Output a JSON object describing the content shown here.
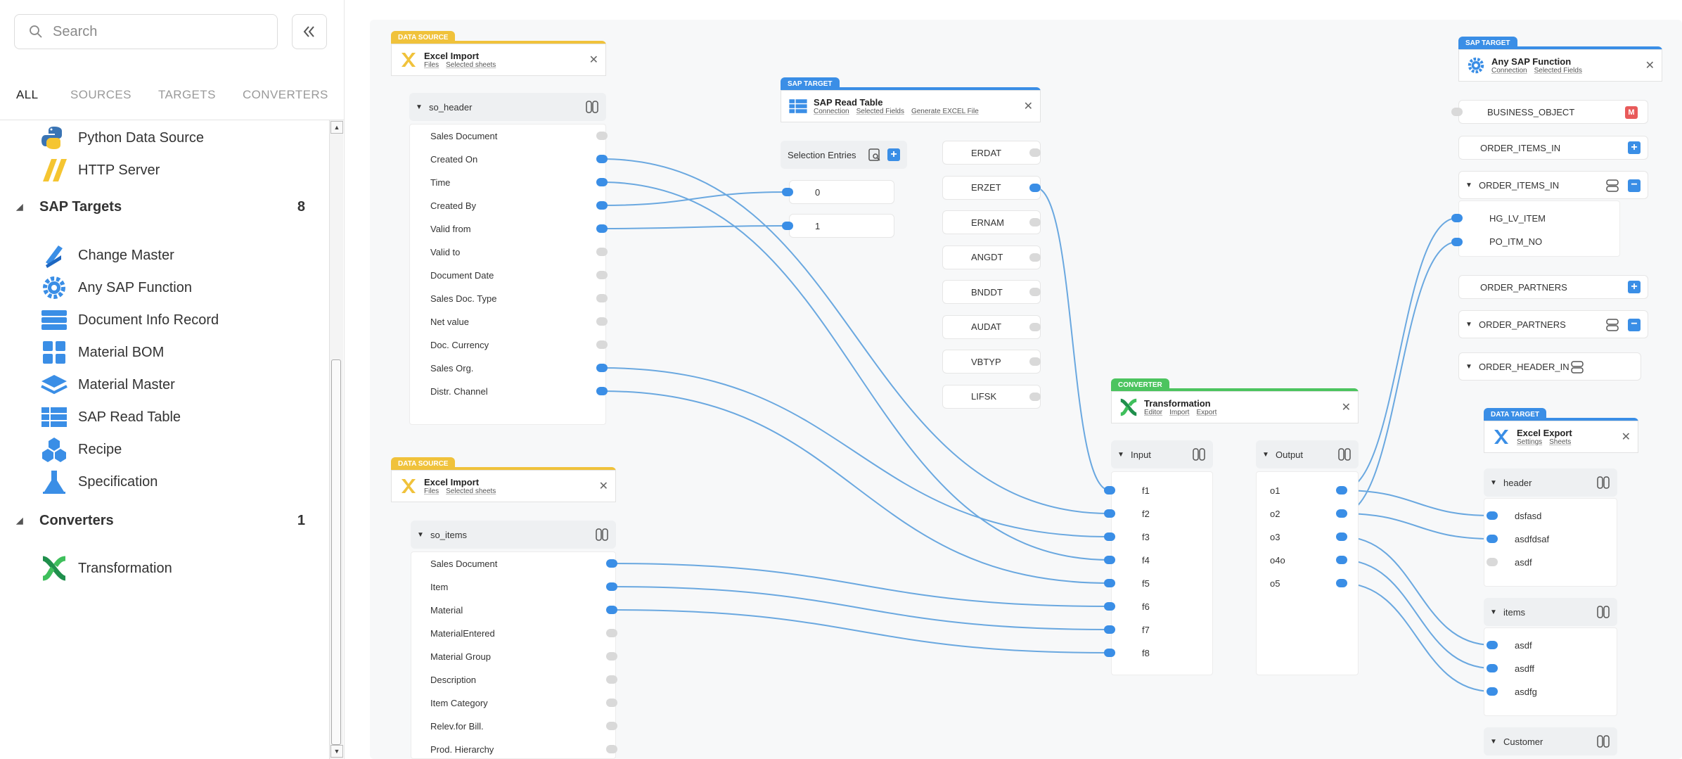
{
  "search": {
    "placeholder": "Search"
  },
  "tabs": [
    {
      "label": "ALL",
      "active": true
    },
    {
      "label": "SOURCES"
    },
    {
      "label": "TARGETS"
    },
    {
      "label": "CONVERTERS"
    }
  ],
  "library": {
    "items_top": [
      {
        "label": "Python Data Source",
        "icon": "python-icon"
      },
      {
        "label": "HTTP Server",
        "icon": "http-server-icon"
      }
    ],
    "sap_targets": {
      "label": "SAP Targets",
      "count": "8",
      "items": [
        {
          "label": "Change Master",
          "icon": "change-master-icon"
        },
        {
          "label": "Any SAP Function",
          "icon": "gear-icon"
        },
        {
          "label": "Document Info Record",
          "icon": "document-info-icon"
        },
        {
          "label": "Material BOM",
          "icon": "material-bom-icon"
        },
        {
          "label": "Material Master",
          "icon": "layers-icon"
        },
        {
          "label": "SAP Read Table",
          "icon": "table-icon"
        },
        {
          "label": "Recipe",
          "icon": "recipe-icon"
        },
        {
          "label": "Specification",
          "icon": "flask-icon"
        }
      ]
    },
    "converters": {
      "label": "Converters",
      "count": "1",
      "items": [
        {
          "label": "Transformation",
          "icon": "transformation-icon"
        }
      ]
    }
  },
  "colors": {
    "source": "#f0c23b",
    "sap_target": "#3a8ee6",
    "converter": "#4cc45f",
    "data_target": "#3a8ee6",
    "wire": "#6aa8e0"
  },
  "nodes": {
    "excel_import_1": {
      "badge": "DATA SOURCE",
      "title": "Excel Import",
      "links": [
        "Files",
        "Selected sheets"
      ],
      "group": "so_header",
      "fields": [
        {
          "label": "Sales Document",
          "connected": false
        },
        {
          "label": "Created On",
          "connected": true
        },
        {
          "label": "Time",
          "connected": true
        },
        {
          "label": "Created By",
          "connected": true
        },
        {
          "label": "Valid from",
          "connected": true
        },
        {
          "label": "Valid to",
          "connected": false
        },
        {
          "label": "Document Date",
          "connected": false
        },
        {
          "label": "Sales Doc. Type",
          "connected": false
        },
        {
          "label": "Net value",
          "connected": false
        },
        {
          "label": "Doc. Currency",
          "connected": false
        },
        {
          "label": "Sales Org.",
          "connected": true
        },
        {
          "label": "Distr. Channel",
          "connected": true
        }
      ]
    },
    "excel_import_2": {
      "badge": "DATA SOURCE",
      "title": "Excel Import",
      "links": [
        "Files",
        "Selected sheets"
      ],
      "group": "so_items",
      "fields": [
        {
          "label": "Sales Document",
          "connected": true
        },
        {
          "label": "Item",
          "connected": true
        },
        {
          "label": "Material",
          "connected": true
        },
        {
          "label": "MaterialEntered",
          "connected": false
        },
        {
          "label": "Material Group",
          "connected": false
        },
        {
          "label": "Description",
          "connected": false
        },
        {
          "label": "Item Category",
          "connected": false
        },
        {
          "label": "Relev.for Bill.",
          "connected": false
        },
        {
          "label": "Prod. Hierarchy",
          "connected": false
        }
      ]
    },
    "sap_read_table": {
      "badge": "SAP TARGET",
      "title": "SAP Read Table",
      "links": [
        "Connection",
        "Selected Fields",
        "Generate EXCEL File"
      ],
      "selection_label": "Selection Entries",
      "entries": [
        "0",
        "1"
      ],
      "fields": [
        {
          "label": "ERDAT",
          "connected": false
        },
        {
          "label": "ERZET",
          "connected": true
        },
        {
          "label": "ERNAM",
          "connected": false
        },
        {
          "label": "ANGDT",
          "connected": false
        },
        {
          "label": "BNDDT",
          "connected": false
        },
        {
          "label": "AUDAT",
          "connected": false
        },
        {
          "label": "VBTYP",
          "connected": false
        },
        {
          "label": "LIFSK",
          "connected": false
        }
      ]
    },
    "transformation": {
      "badge": "CONVERTER",
      "title": "Transformation",
      "links": [
        "Editor",
        "Import",
        "Export"
      ],
      "input_label": "Input",
      "output_label": "Output",
      "inputs": [
        "f1",
        "f2",
        "f3",
        "f4",
        "f5",
        "f6",
        "f7",
        "f8"
      ],
      "outputs": [
        "o1",
        "o2",
        "o3",
        "o4o",
        "o5"
      ]
    },
    "any_sap_function": {
      "badge": "SAP TARGET",
      "title": "Any SAP Function",
      "links": [
        "Connection",
        "Selected Fields"
      ],
      "business_object": "BUSINESS_OBJECT",
      "bo_badge": "M",
      "order_items_in": "ORDER_ITEMS_IN",
      "order_items_group": "ORDER_ITEMS_IN",
      "order_items_fields": [
        "HG_LV_ITEM",
        "PO_ITM_NO"
      ],
      "order_partners": "ORDER_PARTNERS",
      "order_partners_group": "ORDER_PARTNERS",
      "order_header_group": "ORDER_HEADER_IN"
    },
    "excel_export": {
      "badge": "DATA TARGET",
      "title": "Excel Export",
      "links": [
        "Settings",
        "Sheets"
      ],
      "header_group": "header",
      "header_fields": [
        {
          "label": "dsfasd",
          "connected": true
        },
        {
          "label": "asdfdsaf",
          "connected": true
        },
        {
          "label": "asdf",
          "connected": false
        }
      ],
      "items_group": "items",
      "items_fields": [
        {
          "label": "asdf",
          "connected": true
        },
        {
          "label": "asdff",
          "connected": true
        },
        {
          "label": "asdfg",
          "connected": true
        }
      ],
      "customer_group": "Customer"
    }
  }
}
